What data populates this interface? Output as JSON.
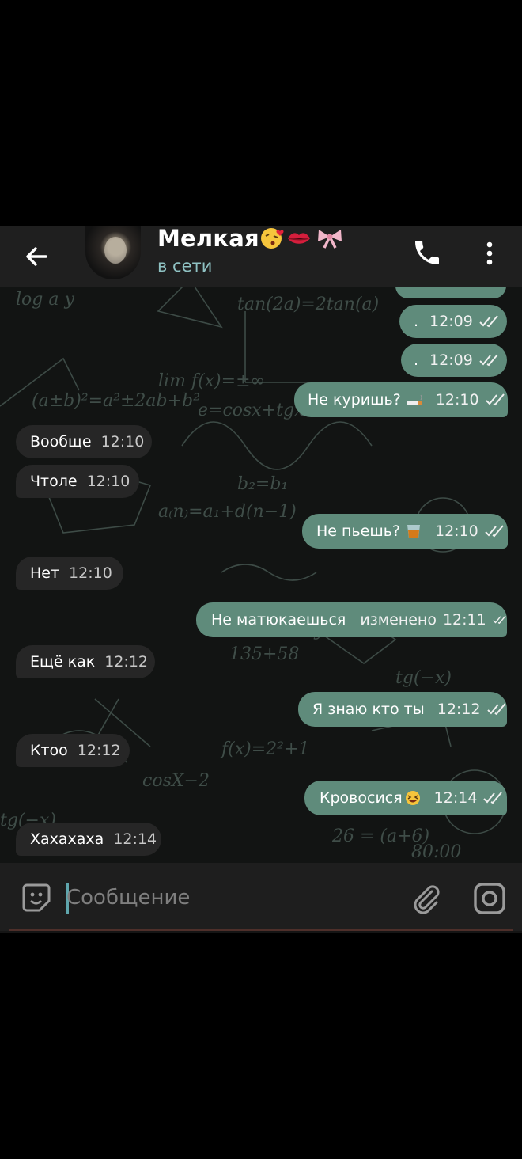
{
  "header": {
    "contact_name": "Мелкая",
    "status": "в сети",
    "icons": [
      "back-arrow-icon",
      "phone-icon",
      "more-vert-icon"
    ]
  },
  "messages": [
    {
      "dir": "out",
      "text": ".",
      "time": "12:09",
      "read": true
    },
    {
      "dir": "out",
      "text": ".",
      "time": "12:09",
      "read": true
    },
    {
      "dir": "out",
      "text": "Не куришь?",
      "emoji": "cigarette",
      "time": "12:10",
      "read": true
    },
    {
      "dir": "in",
      "text": "Вообще",
      "time": "12:10"
    },
    {
      "dir": "in",
      "text": "Чтоле",
      "time": "12:10"
    },
    {
      "dir": "out",
      "text": "Не пьешь?",
      "emoji": "tumbler-glass",
      "time": "12:10",
      "read": true
    },
    {
      "dir": "in",
      "text": "Нет",
      "time": "12:10"
    },
    {
      "dir": "out",
      "text": "Не матюкаешься",
      "edited": "изменено",
      "time": "12:11",
      "read": true
    },
    {
      "dir": "in",
      "text": "Ещё как",
      "time": "12:12"
    },
    {
      "dir": "out",
      "text": "Я знаю кто ты",
      "time": "12:12",
      "read": true
    },
    {
      "dir": "in",
      "text": "Ктоо",
      "time": "12:12"
    },
    {
      "dir": "out",
      "text": "Кровосися",
      "emoji": "grinning-squint",
      "time": "12:14",
      "read": true
    },
    {
      "dir": "in",
      "text": "Хахахаха",
      "time": "12:14"
    }
  ],
  "input": {
    "placeholder": "Сообщение",
    "icons": [
      "emoji-icon",
      "attach-icon",
      "camera-icon"
    ]
  },
  "colors": {
    "outgoing_bubble": "#5f8b7b",
    "incoming_bubble": "#262626",
    "status": "#8fc2c3",
    "header_bg": "#1f1f1f"
  }
}
